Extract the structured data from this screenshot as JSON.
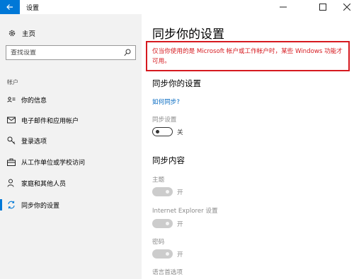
{
  "window": {
    "title": "设置",
    "back_icon": "back-arrow-icon",
    "minimize_glyph": "—",
    "maximize_glyph": "☐",
    "close_glyph": "✕"
  },
  "sidebar": {
    "home_label": "主页",
    "search_placeholder": "查找设置",
    "group_label": "帐户",
    "items": [
      {
        "label": "你的信息",
        "icon": "contact-card-icon"
      },
      {
        "label": "电子邮件和应用帐户",
        "icon": "mail-icon"
      },
      {
        "label": "登录选项",
        "icon": "key-icon"
      },
      {
        "label": "从工作单位或学校访问",
        "icon": "briefcase-icon"
      },
      {
        "label": "家庭和其他人员",
        "icon": "person-icon"
      },
      {
        "label": "同步你的设置",
        "icon": "sync-icon",
        "active": true
      }
    ]
  },
  "main": {
    "page_title": "同步你的设置",
    "notice": "仅当你使用的是 Microsoft 帐户或工作帐户时，某些 Windows 功能才可用。",
    "section1_title": "同步你的设置",
    "how_link": "如何同步?",
    "sync_label": "同步设置",
    "sync_state": "关",
    "section2_title": "同步内容",
    "items": [
      {
        "label": "主题",
        "state": "开"
      },
      {
        "label": "Internet Explorer 设置",
        "state": "开"
      },
      {
        "label": "密码",
        "state": "开"
      }
    ],
    "cut_label": "语言首选项"
  },
  "colors": {
    "accent": "#0078d7",
    "notice_red": "#d6191f",
    "link_blue": "#0067c0",
    "disabled_grey": "#8a8a8a"
  }
}
